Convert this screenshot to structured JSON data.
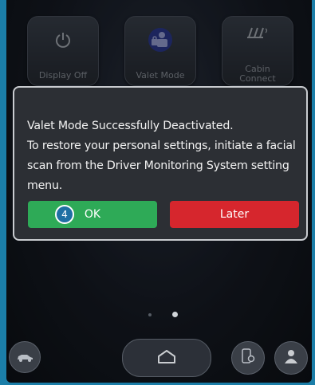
{
  "tiles": [
    {
      "label": "Display Off",
      "icon": "power-icon"
    },
    {
      "label": "Valet Mode",
      "icon": "valet-icon"
    },
    {
      "label": "Cabin Connect",
      "icon": "cabin-connect-icon"
    }
  ],
  "dialog": {
    "line1": "Valet Mode Successfully Deactivated.",
    "line2": "To restore your personal settings, initiate a facial scan from the Driver Monitoring System setting menu.",
    "ok_label": "OK",
    "later_label": "Later",
    "step_number": "4"
  },
  "colors": {
    "ok": "#2eaa57",
    "later": "#d6262d",
    "step_badge": "#1f6fa3",
    "frame": "#1b7ea8"
  },
  "bottom_icons": [
    "car-icon",
    "home-icon",
    "phone-settings-icon",
    "profile-icon"
  ]
}
